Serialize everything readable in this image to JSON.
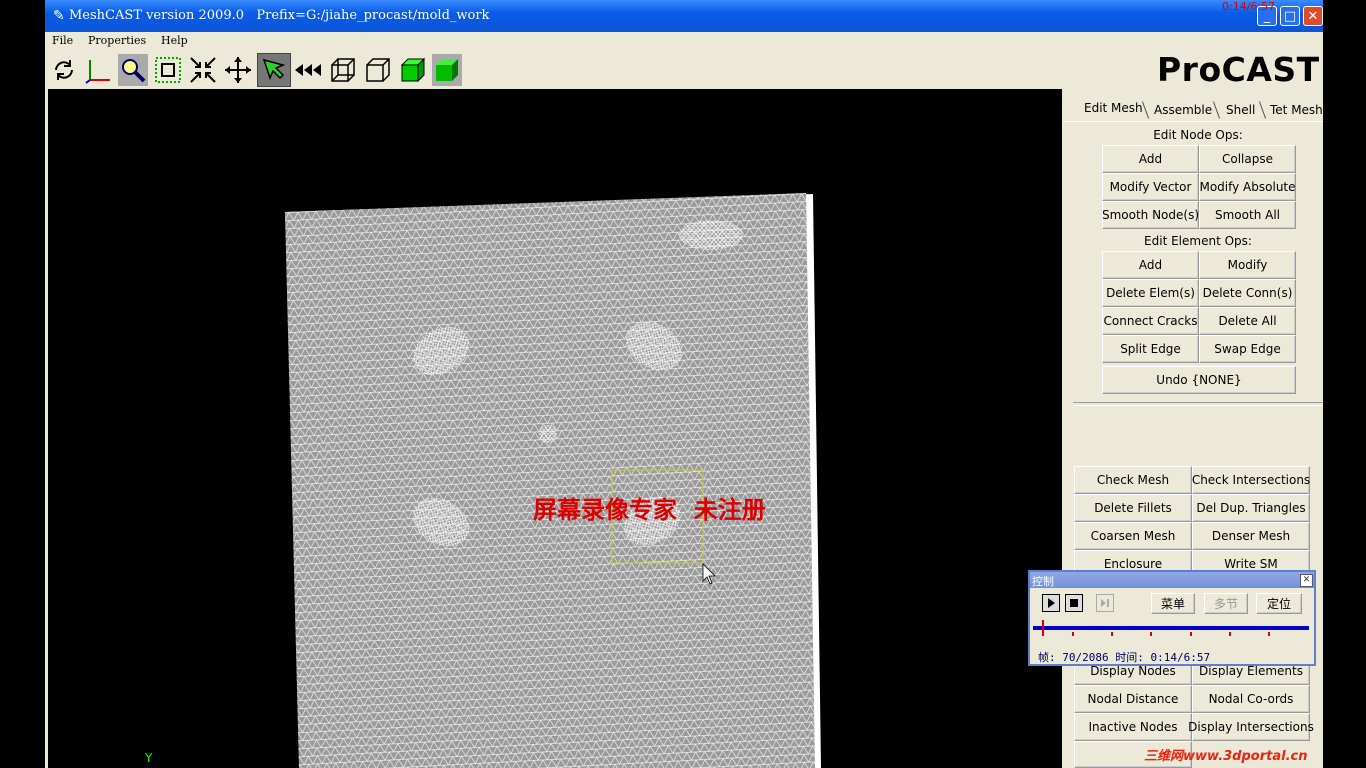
{
  "window": {
    "title": "MeshCAST version 2009.0   Prefix=G:/jiahe_procast/mold_work",
    "title_icon": "feather-icon",
    "controls": {
      "minimize": "_",
      "maximize": "□",
      "close": "✕"
    }
  },
  "menu": [
    "File",
    "Properties",
    "Help"
  ],
  "toolbar": [
    {
      "icon": "rotate-icon"
    },
    {
      "icon": "axes-icon"
    },
    {
      "icon": "zoom-icon"
    },
    {
      "icon": "zoom-box-icon"
    },
    {
      "icon": "shrink-icon"
    },
    {
      "icon": "pan-icon"
    },
    {
      "icon": "pick-icon"
    },
    {
      "icon": "rewind-icon"
    },
    {
      "icon": "wireframe-box-icon"
    },
    {
      "icon": "outline-box-icon"
    },
    {
      "icon": "shaded-box-icon"
    },
    {
      "icon": "solid-box-icon"
    }
  ],
  "logo": "ProCAST",
  "tabs": [
    "Edit Mesh",
    "Assemble",
    "Shell",
    "Tet Mesh"
  ],
  "edit_node_ops": {
    "title": "Edit Node Ops:",
    "buttons": [
      "Add",
      "Collapse",
      "Modify Vector",
      "Modify Absolute",
      "Smooth Node(s)",
      "Smooth All"
    ]
  },
  "edit_element_ops": {
    "title": "Edit Element Ops:",
    "buttons": [
      "Add",
      "Modify",
      "Delete Elem(s)",
      "Delete Conn(s)",
      "Connect Cracks",
      "Delete All",
      "Split Edge",
      "Swap Edge"
    ]
  },
  "undo": "Undo {NONE}",
  "mesh_tools": [
    "Check Mesh",
    "Check Intersections",
    "Delete Fillets",
    "Del Dup. Triangles",
    "Coarsen Mesh",
    "Denser Mesh",
    "Enclosure",
    "Write SM"
  ],
  "display_tools": [
    "Display Nodes",
    "Display Elements",
    "Nodal Distance",
    "Nodal Co-ords",
    "Inactive Nodes",
    "Display Intersections"
  ],
  "axis_label": "Y",
  "overlay": {
    "recording_watermark": "屏幕录像专家  未注册",
    "site_watermark": "三维网www.3dportal.cn",
    "recording_time": "0:14/6:57"
  },
  "player": {
    "title": "控制",
    "buttons": [
      "菜单",
      "多节",
      "定位"
    ],
    "status": "帧: 70/2086 时间: 0:14/6:57",
    "progress": 0.034
  }
}
